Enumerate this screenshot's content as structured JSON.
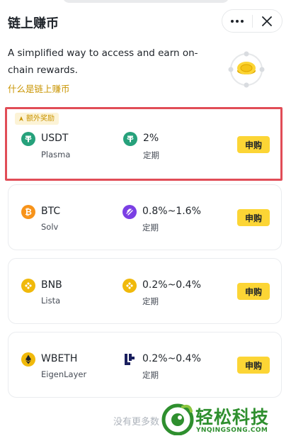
{
  "header": {
    "title": "链上赚币",
    "more_icon": "more-dots-icon",
    "close_icon": "close-icon"
  },
  "intro": {
    "description": "A simplified way to access and earn on-chain rewards.",
    "link_label": "什么是链上赚币",
    "hero_icon": "coin-orbit-illustration"
  },
  "products": [
    {
      "badge": "额外奖励",
      "coin": "USDT",
      "network": "Plasma",
      "coin_icon": "tether-icon",
      "protocol_icon": "tether-icon",
      "rate": "2%",
      "term": "定期",
      "action": "申购"
    },
    {
      "coin": "BTC",
      "network": "Solv",
      "coin_icon": "bitcoin-icon",
      "protocol_icon": "solv-icon",
      "rate": "0.8%~1.6%",
      "term": "定期",
      "action": "申购"
    },
    {
      "coin": "BNB",
      "network": "Lista",
      "coin_icon": "bnb-icon",
      "protocol_icon": "bnb-icon",
      "rate": "0.2%~0.4%",
      "term": "定期",
      "action": "申购"
    },
    {
      "coin": "WBETH",
      "network": "EigenLayer",
      "coin_icon": "ethereum-icon",
      "protocol_icon": "eigenlayer-icon",
      "rate": "0.2%~0.4%",
      "term": "定期",
      "action": "申购"
    }
  ],
  "footer": {
    "note": "没有更多数"
  },
  "watermark": {
    "title": "轻松科技",
    "subtitle": "YNQINGSONG.COM"
  },
  "colors": {
    "accent_yellow": "#fcd535",
    "link_gold": "#c99400",
    "highlight_red": "#e14d57",
    "tether_green": "#26a17b",
    "bitcoin_orange": "#f7931a",
    "bnb_yellow": "#f0b90b",
    "solv_purple": "#7b3fe4",
    "eigen_navy": "#1a1f5e",
    "watermark_green": "#2e8f2e"
  }
}
